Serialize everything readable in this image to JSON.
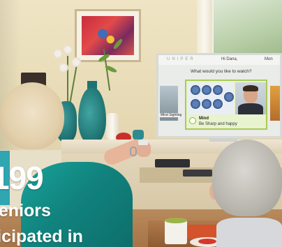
{
  "overlay": {
    "number": "199",
    "line1": "seniors",
    "line2": "participated in"
  },
  "tv_screen": {
    "brand": "UNIPER",
    "greeting": "Hi Dana,",
    "greeting_tail": "Mon",
    "question": "What would you like to watch?",
    "left_thumb_label": "Mind Sighting",
    "card_title": "Mind",
    "card_subtitle": "Be Sharp and happy"
  },
  "colors": {
    "accent": "#2fa6b0",
    "card_border": "#aacb55",
    "overlay_text": "#ffffff"
  }
}
